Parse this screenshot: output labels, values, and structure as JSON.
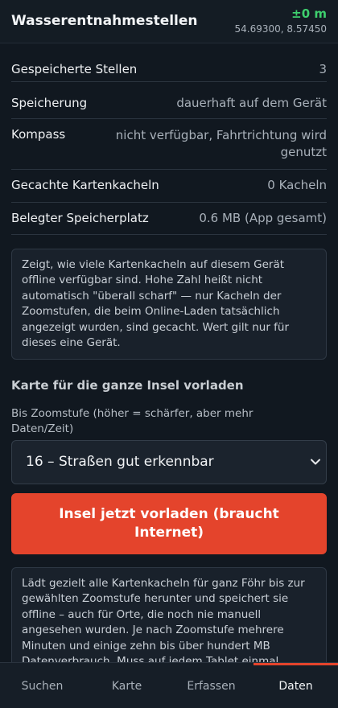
{
  "header": {
    "title": "Wasserentnahmestellen",
    "altitude": "±0 m",
    "coordinates": "54.69300, 8.57450"
  },
  "stats": [
    {
      "label": "Gespeicherte Stellen",
      "value": "3"
    },
    {
      "label": "Speicherung",
      "value": "dauerhaft auf dem Gerät"
    },
    {
      "label": "Kompass",
      "value_lines": [
        "nicht verfügbar, Fahrtrichtung wird",
        "genutzt"
      ]
    },
    {
      "label": "Gecachte Kartenkacheln",
      "value": "0 Kacheln"
    },
    {
      "label": "Belegter Speicherplatz",
      "value": "0.6 MB (App gesamt)"
    }
  ],
  "cache_info": {
    "lines": [
      "Zeigt, wie viele Kartenkacheln auf diesem Gerät",
      "offline verfügbar sind. Hohe Zahl heißt nicht",
      "automatisch \"überall scharf\" — nur Kacheln der",
      "Zoomstufen, die beim Online-Laden tatsächlich",
      "angezeigt wurden, sind gecacht. Wert gilt nur für",
      "dieses eine Gerät."
    ]
  },
  "preload": {
    "section_title": "Karte für die ganze Insel vorladen",
    "zoom_label_lines": [
      "Bis Zoomstufe (höher = schärfer, aber mehr",
      "Daten/Zeit)"
    ],
    "zoom_selected": "16 – Straßen gut erkennbar",
    "button_lines": [
      "Insel jetzt vorladen (braucht",
      "Internet)"
    ],
    "info_lines": [
      "Lädt gezielt alle Kartenkacheln für ganz Föhr bis zur",
      "gewählten Zoomstufe herunter und speichert sie",
      "offline – auch für Orte, die noch nie manuell",
      "angesehen wurden. Je nach Zoomstufe mehrere",
      "Minuten und einige zehn bis über hundert MB",
      "Datenverbrauch. Muss auf jedem Tablet einmal"
    ]
  },
  "tabs": [
    {
      "label": "Suchen",
      "active": false
    },
    {
      "label": "Karte",
      "active": false
    },
    {
      "label": "Erfassen",
      "active": false
    },
    {
      "label": "Daten",
      "active": true
    }
  ],
  "colors": {
    "background": "#111820",
    "accent": "#e4442c",
    "altitude_green": "#3ecf6e"
  }
}
